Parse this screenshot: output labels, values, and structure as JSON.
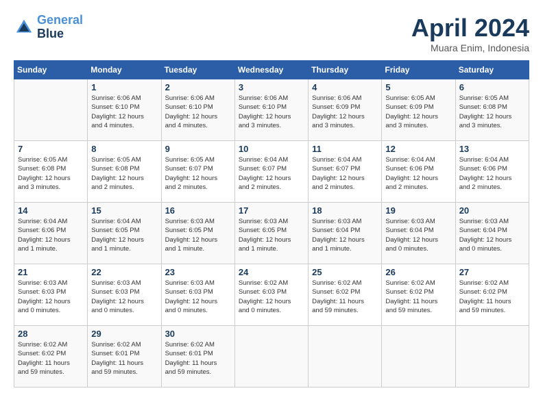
{
  "header": {
    "logo_line1": "General",
    "logo_line2": "Blue",
    "title": "April 2024",
    "subtitle": "Muara Enim, Indonesia"
  },
  "weekdays": [
    "Sunday",
    "Monday",
    "Tuesday",
    "Wednesday",
    "Thursday",
    "Friday",
    "Saturday"
  ],
  "weeks": [
    [
      {
        "num": "",
        "info": ""
      },
      {
        "num": "1",
        "info": "Sunrise: 6:06 AM\nSunset: 6:10 PM\nDaylight: 12 hours\nand 4 minutes."
      },
      {
        "num": "2",
        "info": "Sunrise: 6:06 AM\nSunset: 6:10 PM\nDaylight: 12 hours\nand 4 minutes."
      },
      {
        "num": "3",
        "info": "Sunrise: 6:06 AM\nSunset: 6:10 PM\nDaylight: 12 hours\nand 3 minutes."
      },
      {
        "num": "4",
        "info": "Sunrise: 6:06 AM\nSunset: 6:09 PM\nDaylight: 12 hours\nand 3 minutes."
      },
      {
        "num": "5",
        "info": "Sunrise: 6:05 AM\nSunset: 6:09 PM\nDaylight: 12 hours\nand 3 minutes."
      },
      {
        "num": "6",
        "info": "Sunrise: 6:05 AM\nSunset: 6:08 PM\nDaylight: 12 hours\nand 3 minutes."
      }
    ],
    [
      {
        "num": "7",
        "info": "Sunrise: 6:05 AM\nSunset: 6:08 PM\nDaylight: 12 hours\nand 3 minutes."
      },
      {
        "num": "8",
        "info": "Sunrise: 6:05 AM\nSunset: 6:08 PM\nDaylight: 12 hours\nand 2 minutes."
      },
      {
        "num": "9",
        "info": "Sunrise: 6:05 AM\nSunset: 6:07 PM\nDaylight: 12 hours\nand 2 minutes."
      },
      {
        "num": "10",
        "info": "Sunrise: 6:04 AM\nSunset: 6:07 PM\nDaylight: 12 hours\nand 2 minutes."
      },
      {
        "num": "11",
        "info": "Sunrise: 6:04 AM\nSunset: 6:07 PM\nDaylight: 12 hours\nand 2 minutes."
      },
      {
        "num": "12",
        "info": "Sunrise: 6:04 AM\nSunset: 6:06 PM\nDaylight: 12 hours\nand 2 minutes."
      },
      {
        "num": "13",
        "info": "Sunrise: 6:04 AM\nSunset: 6:06 PM\nDaylight: 12 hours\nand 2 minutes."
      }
    ],
    [
      {
        "num": "14",
        "info": "Sunrise: 6:04 AM\nSunset: 6:06 PM\nDaylight: 12 hours\nand 1 minute."
      },
      {
        "num": "15",
        "info": "Sunrise: 6:04 AM\nSunset: 6:05 PM\nDaylight: 12 hours\nand 1 minute."
      },
      {
        "num": "16",
        "info": "Sunrise: 6:03 AM\nSunset: 6:05 PM\nDaylight: 12 hours\nand 1 minute."
      },
      {
        "num": "17",
        "info": "Sunrise: 6:03 AM\nSunset: 6:05 PM\nDaylight: 12 hours\nand 1 minute."
      },
      {
        "num": "18",
        "info": "Sunrise: 6:03 AM\nSunset: 6:04 PM\nDaylight: 12 hours\nand 1 minute."
      },
      {
        "num": "19",
        "info": "Sunrise: 6:03 AM\nSunset: 6:04 PM\nDaylight: 12 hours\nand 0 minutes."
      },
      {
        "num": "20",
        "info": "Sunrise: 6:03 AM\nSunset: 6:04 PM\nDaylight: 12 hours\nand 0 minutes."
      }
    ],
    [
      {
        "num": "21",
        "info": "Sunrise: 6:03 AM\nSunset: 6:03 PM\nDaylight: 12 hours\nand 0 minutes."
      },
      {
        "num": "22",
        "info": "Sunrise: 6:03 AM\nSunset: 6:03 PM\nDaylight: 12 hours\nand 0 minutes."
      },
      {
        "num": "23",
        "info": "Sunrise: 6:03 AM\nSunset: 6:03 PM\nDaylight: 12 hours\nand 0 minutes."
      },
      {
        "num": "24",
        "info": "Sunrise: 6:02 AM\nSunset: 6:03 PM\nDaylight: 12 hours\nand 0 minutes."
      },
      {
        "num": "25",
        "info": "Sunrise: 6:02 AM\nSunset: 6:02 PM\nDaylight: 11 hours\nand 59 minutes."
      },
      {
        "num": "26",
        "info": "Sunrise: 6:02 AM\nSunset: 6:02 PM\nDaylight: 11 hours\nand 59 minutes."
      },
      {
        "num": "27",
        "info": "Sunrise: 6:02 AM\nSunset: 6:02 PM\nDaylight: 11 hours\nand 59 minutes."
      }
    ],
    [
      {
        "num": "28",
        "info": "Sunrise: 6:02 AM\nSunset: 6:02 PM\nDaylight: 11 hours\nand 59 minutes."
      },
      {
        "num": "29",
        "info": "Sunrise: 6:02 AM\nSunset: 6:01 PM\nDaylight: 11 hours\nand 59 minutes."
      },
      {
        "num": "30",
        "info": "Sunrise: 6:02 AM\nSunset: 6:01 PM\nDaylight: 11 hours\nand 59 minutes."
      },
      {
        "num": "",
        "info": ""
      },
      {
        "num": "",
        "info": ""
      },
      {
        "num": "",
        "info": ""
      },
      {
        "num": "",
        "info": ""
      }
    ]
  ]
}
